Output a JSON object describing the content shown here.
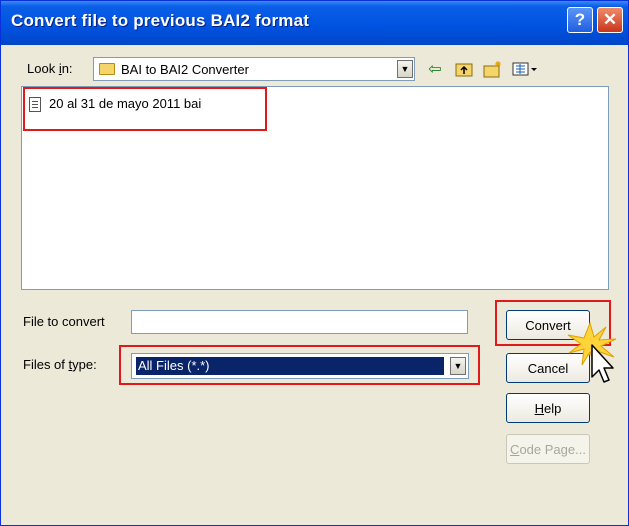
{
  "dialog": {
    "title": "Convert file to previous BAI2 format",
    "help_glyph": "?",
    "close_glyph": "✕"
  },
  "look_in": {
    "label_pre": "Look ",
    "label_key": "i",
    "label_post": "n:",
    "value": "BAI to BAI2 Converter"
  },
  "toolbar": {
    "back_glyph": "⇦",
    "up_glyph": "🗀",
    "new_folder_glyph": "🗀",
    "views_glyph": "▦▾"
  },
  "files": [
    {
      "name": "20 al 31 de mayo 2011 bai"
    }
  ],
  "file_to_convert": {
    "label": "File to convert",
    "value": ""
  },
  "files_of_type": {
    "label_pre": "Files of ",
    "label_key": "t",
    "label_post": "ype:",
    "value": "All Files (*.*)"
  },
  "buttons": {
    "convert": "Convert",
    "cancel": "Cancel",
    "help_key": "H",
    "help_rest": "elp",
    "code_page_key": "C",
    "code_page_rest": "ode Page..."
  },
  "colors": {
    "highlight": "#e01a1a",
    "titlebar": "#0052e0",
    "selection": "#0a246a"
  }
}
